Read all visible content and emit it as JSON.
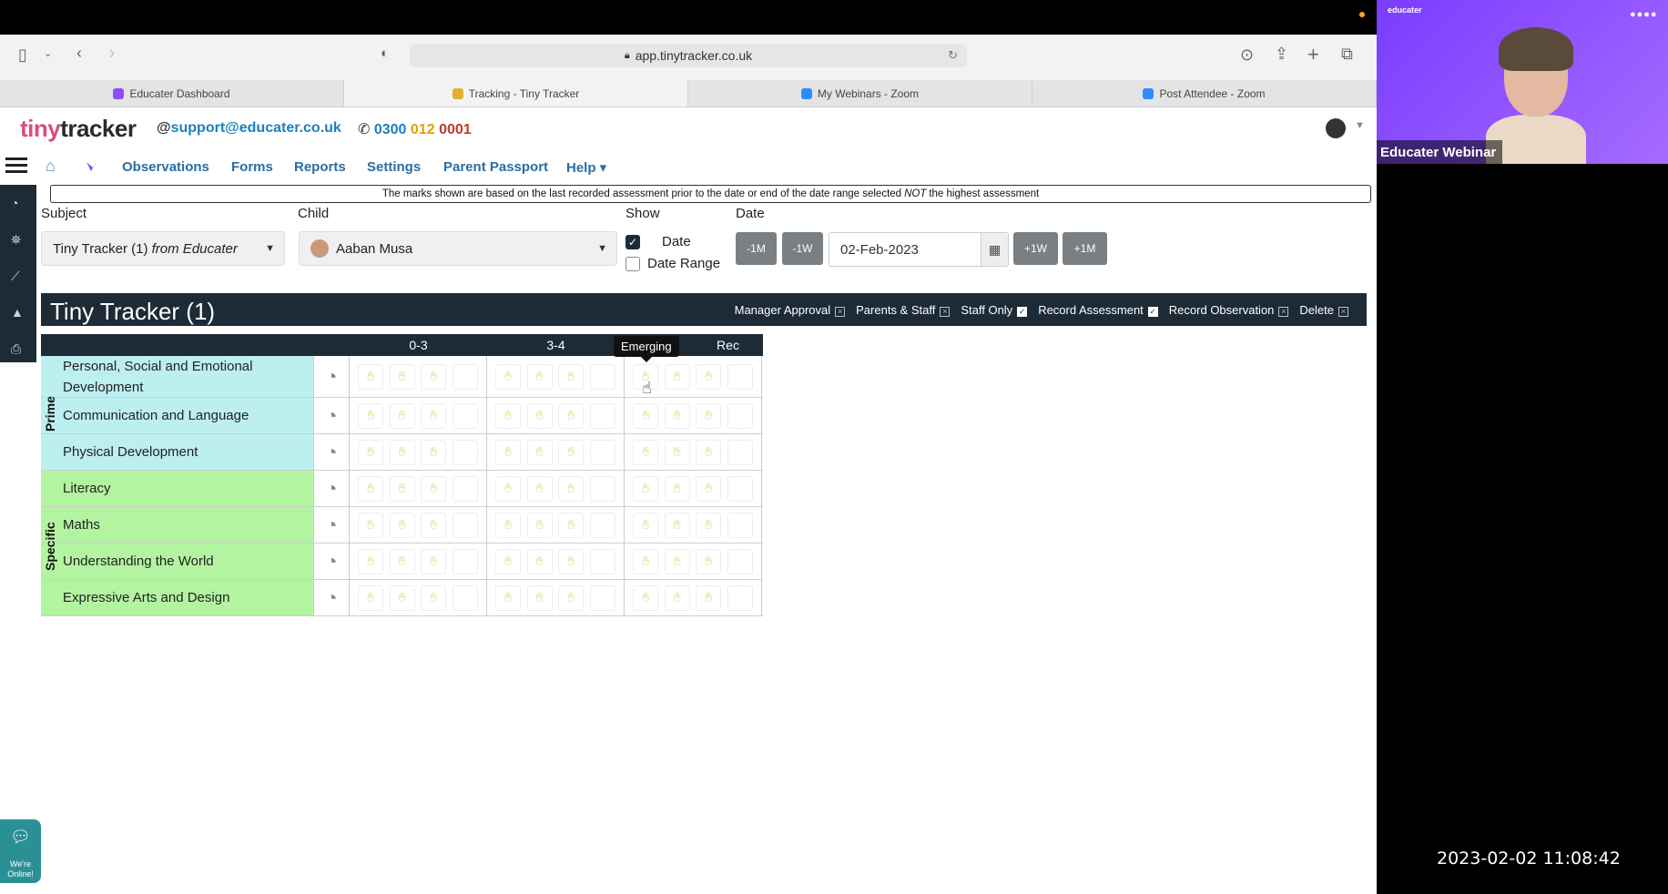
{
  "browser": {
    "address": "app.tinytracker.co.uk",
    "tabs": [
      {
        "label": "Educater Dashboard",
        "icon_color": "#8b4dff"
      },
      {
        "label": "Tracking - Tiny Tracker",
        "icon_color": "#e0b030",
        "active": true
      },
      {
        "label": "My Webinars - Zoom",
        "icon_color": "#2d8cff"
      },
      {
        "label": "Post Attendee - Zoom",
        "icon_color": "#2d8cff"
      }
    ]
  },
  "header": {
    "logo_tiny": "tiny",
    "logo_tracker": "tracker",
    "email_at": "@",
    "email": "support@educater.co.uk",
    "phone_icon": "phone-icon",
    "phone_a": "0300",
    "phone_b": "012",
    "phone_c": "0001"
  },
  "nav": {
    "items": [
      "Observations",
      "Forms",
      "Reports",
      "Settings",
      "Parent Passport",
      "Help ▾"
    ]
  },
  "notice": {
    "pre": "The marks shown are based on the last recorded assessment prior to the date or end of the date range selected ",
    "em": "NOT",
    "post": " the highest assessment"
  },
  "filters": {
    "subject_label": "Subject",
    "subject_value": "Tiny Tracker (1) ",
    "subject_suffix": "from Educater",
    "child_label": "Child",
    "child_value": "Aaban Musa",
    "show_label": "Show",
    "show_date": "Date",
    "show_date_range": "Date Range",
    "date_label": "Date",
    "date_value": "02-Feb-2023",
    "btn_minus_month": "-1M",
    "btn_minus_week": "-1W",
    "btn_plus_week": "+1W",
    "btn_plus_month": "+1M"
  },
  "tracker": {
    "title": "Tiny Tracker (1)",
    "permissions": [
      {
        "label": "Manager Approval",
        "checked": false
      },
      {
        "label": "Parents & Staff",
        "checked": false
      },
      {
        "label": "Staff Only",
        "checked": true
      },
      {
        "label": "Record Assessment",
        "checked": true
      },
      {
        "label": "Record Observation",
        "checked": false
      },
      {
        "label": "Delete",
        "checked": false
      }
    ],
    "columns": [
      "0-3",
      "3-4",
      "Rec"
    ],
    "groups": [
      {
        "name": "Prime",
        "rows": [
          "Personal, Social and Emotional Development",
          "Communication and Language",
          "Physical Development"
        ]
      },
      {
        "name": "Specific",
        "rows": [
          "Literacy",
          "Maths",
          "Understanding the World",
          "Expressive Arts and Design"
        ]
      }
    ],
    "tooltip": "Emerging"
  },
  "chat": {
    "line1": "We're",
    "line2": "Online!"
  },
  "video": {
    "label": "Educater Webinar",
    "logo": "educater",
    "timestamp": "2023-02-02 11:08:42"
  },
  "colors": {
    "dark_navy": "#1d2b37",
    "prime": "#bdeff0",
    "specific": "#b3f4a0",
    "link": "#2a6ea3"
  }
}
